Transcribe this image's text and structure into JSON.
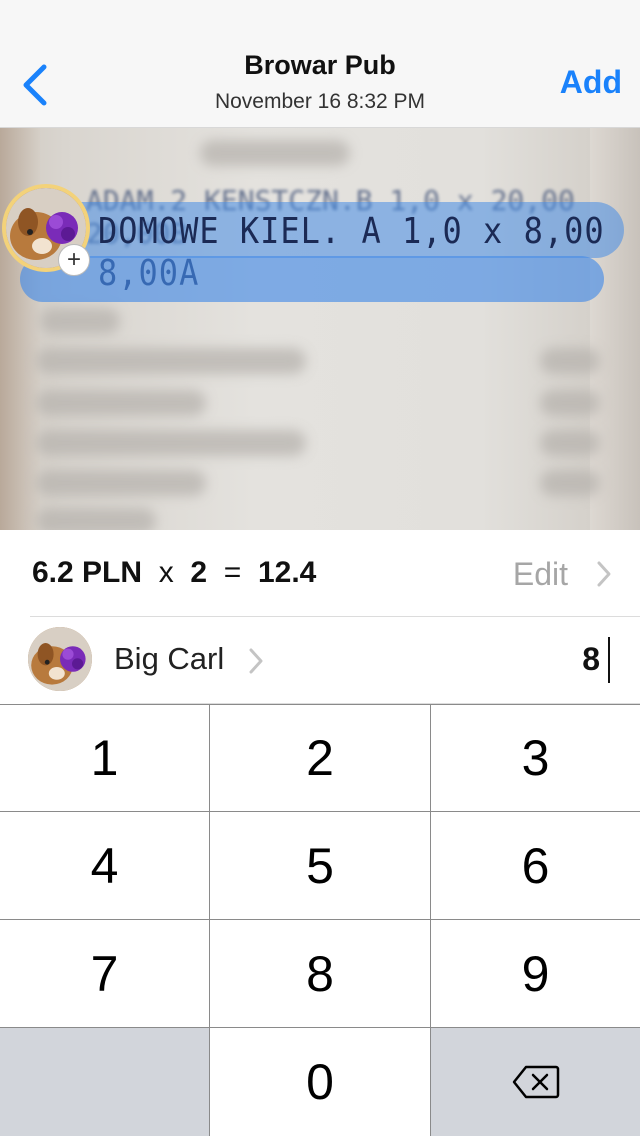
{
  "nav": {
    "title": "Browar Pub",
    "subtitle": "November 16  8:32 PM",
    "add_label": "Add",
    "back_icon": "chevron-left-icon",
    "accent": "#1a82fb"
  },
  "photo": {
    "receipt_line": "DOMOWE KIEL. A 1,0 x 8,00   8,00A",
    "receipt_line_above": "ADAM.2 KENSTCZN.B 1,0 x 20,00  20,00B",
    "highlight_color": "#468ce6",
    "add_person_symbol": "+"
  },
  "item": {
    "price": "6.2 PLN",
    "times": "x",
    "quantity": "2",
    "equals": "=",
    "total": "12.4",
    "edit_label": "Edit"
  },
  "person": {
    "name": "Big Carl",
    "amount": "8"
  },
  "keypad": {
    "keys": [
      "1",
      "2",
      "3",
      "4",
      "5",
      "6",
      "7",
      "8",
      "9",
      "0"
    ],
    "delete_icon": "backspace-icon"
  }
}
